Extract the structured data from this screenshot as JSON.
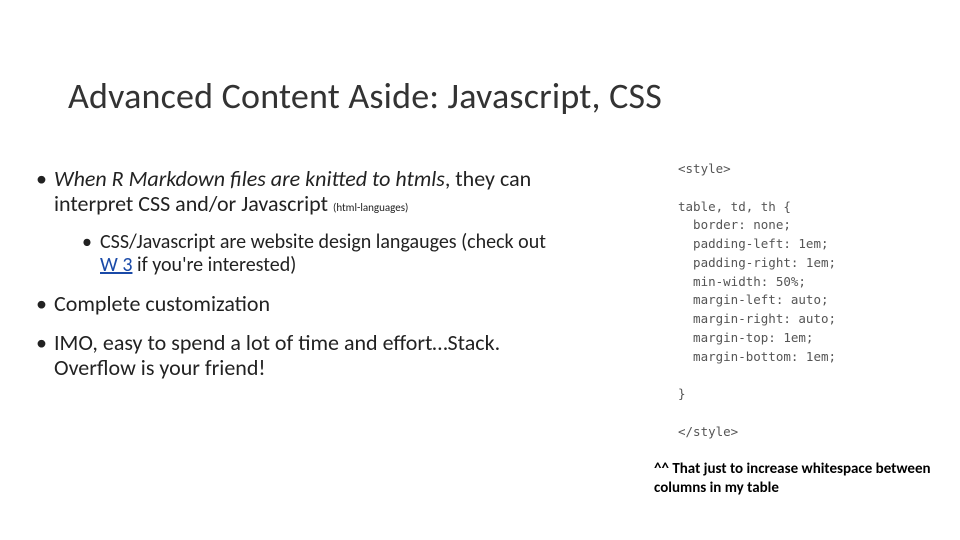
{
  "title": "Advanced Content Aside: Javascript, CSS",
  "b1": {
    "pre": "When R Markdown files are knitted to htmls",
    "post": ", they can interpret CSS and/or Javascript ",
    "small": "(html-languages)"
  },
  "b2": {
    "pre": "CSS/Javascript are website design langauges (check out ",
    "link": "W 3",
    "post": " if you're interested)"
  },
  "b3": "Complete customization",
  "b4": "IMO, easy to spend a lot of time and effort…Stack. Overflow is your friend!",
  "code": "<style>\n\ntable, td, th {\n  border: none;\n  padding-left: 1em;\n  padding-right: 1em;\n  min-width: 50%;\n  margin-left: auto;\n  margin-right: auto;\n  margin-top: 1em;\n  margin-bottom: 1em;\n\n}\n\n</style>",
  "caption": "^^ That just to increase whitespace between columns in my table"
}
